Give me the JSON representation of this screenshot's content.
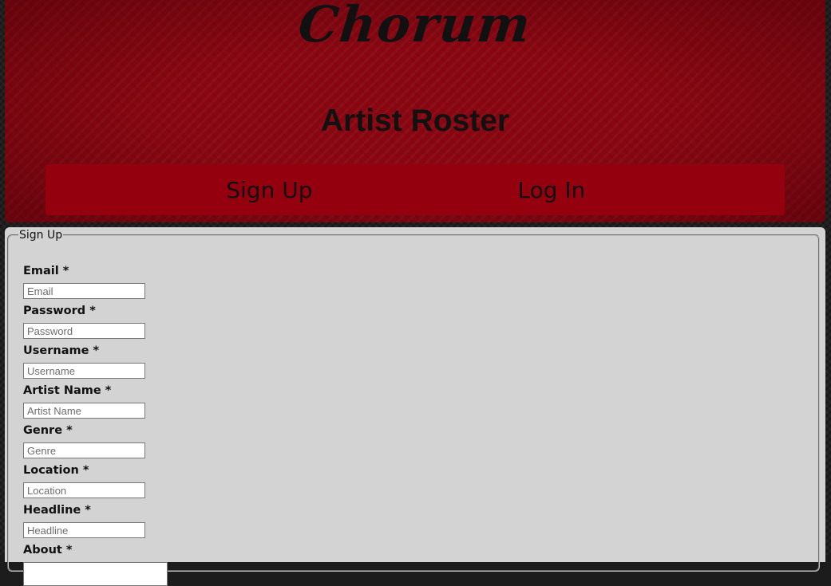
{
  "header": {
    "logo_text": "Chorum",
    "page_title": "Artist Roster",
    "nav": [
      {
        "label": "Sign Up"
      },
      {
        "label": "Log In"
      }
    ]
  },
  "form": {
    "legend": "Sign Up",
    "fields": [
      {
        "label": "Email *",
        "placeholder": "Email"
      },
      {
        "label": "Password *",
        "placeholder": "Password"
      },
      {
        "label": "Username *",
        "placeholder": "Username"
      },
      {
        "label": "Artist Name *",
        "placeholder": "Artist Name"
      },
      {
        "label": "Genre *",
        "placeholder": "Genre"
      },
      {
        "label": "Location *",
        "placeholder": "Location"
      },
      {
        "label": "Headline *",
        "placeholder": "Headline"
      },
      {
        "label": "About *",
        "placeholder": ""
      }
    ]
  },
  "colors": {
    "header_red": "#8a0712",
    "nav_red": "#95000f",
    "form_bg": "#d3d3d3",
    "page_bg": "#1f1f1f"
  }
}
